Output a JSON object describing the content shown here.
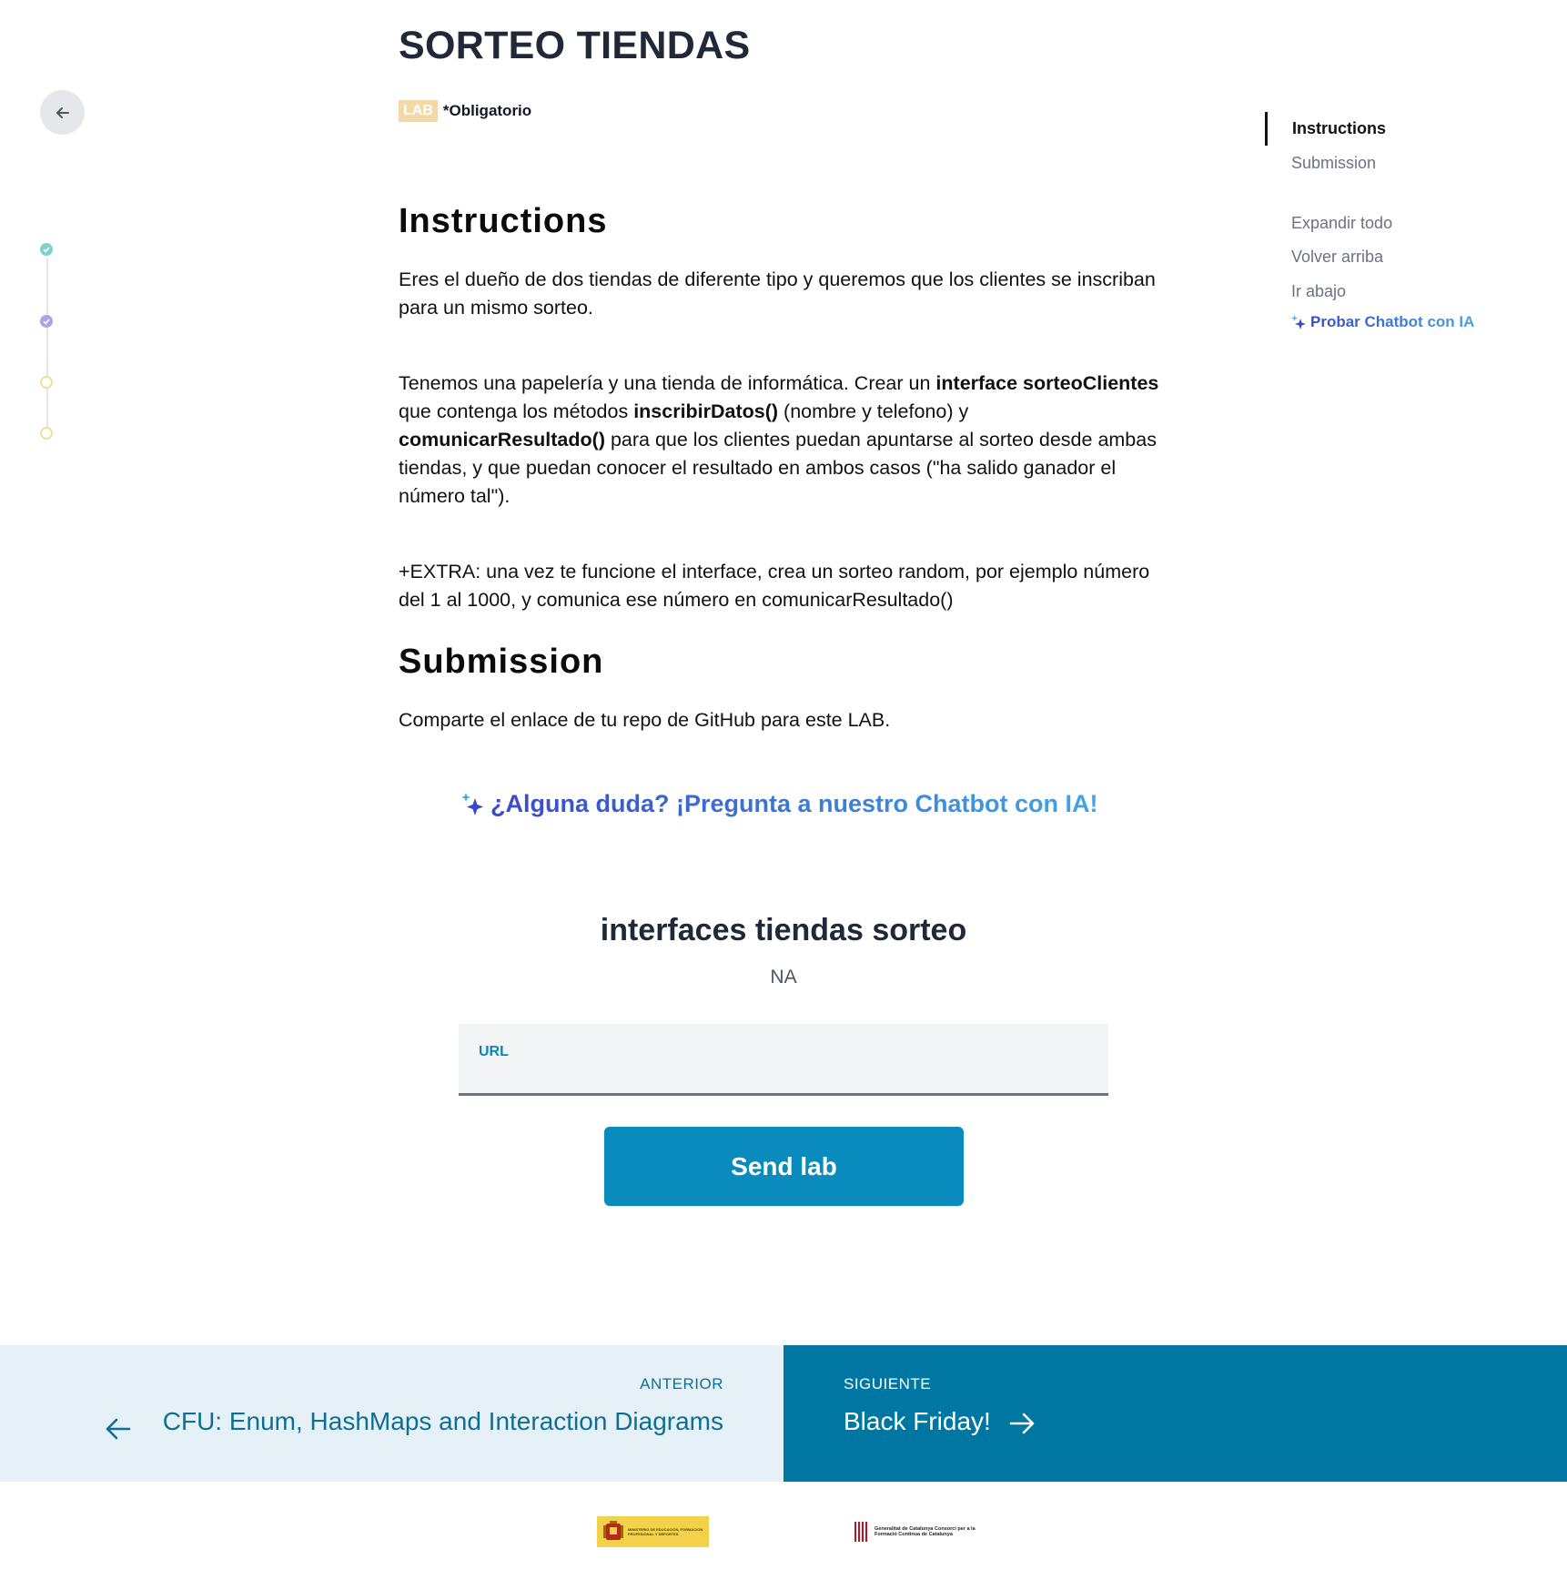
{
  "page": {
    "title": "SORTEO TIENDAS",
    "badge": "LAB",
    "required": "*Obligatorio"
  },
  "instructions": {
    "heading": "Instructions",
    "p1": "Eres el dueño de dos tiendas de diferente tipo y queremos que los clientes se inscriban para un mismo sorteo.",
    "p2": {
      "t1": "Tenemos una papelería y una tienda de informática. Crear un ",
      "b1": "interface sorteoClientes",
      "t2": " que contenga los métodos ",
      "b2": "inscribirDatos()",
      "t3": " (nombre y telefono) y ",
      "b3": "comunicarResultado()",
      "t4": " para que los clientes puedan apuntarse al sorteo desde ambas tiendas, y que puedan conocer el resultado en ambos casos (\"ha salido ganador el número tal\")."
    },
    "p3": "+EXTRA: una vez te funcione el interface, crea un sorteo random, por ejemplo número del 1 al 1000, y comunica ese número en comunicarResultado()"
  },
  "submission": {
    "heading": "Submission",
    "text": "Comparte el enlace de tu repo de GitHub para este LAB."
  },
  "chatbot_cta": "¿Alguna duda? ¡Pregunta a nuestro Chatbot con IA!",
  "card": {
    "title": "interfaces tiendas sorteo",
    "subtitle": "NA",
    "url_label": "URL",
    "url_value": "",
    "submit_label": "Send lab"
  },
  "toc": {
    "items": [
      "Instructions",
      "Submission"
    ],
    "active": "Instructions",
    "actions": [
      "Expandir todo",
      "Volver arriba",
      "Ir abajo"
    ],
    "chatbot": "Probar Chatbot con IA"
  },
  "progress_steps": [
    {
      "state": "done",
      "color": "#7fd3c9"
    },
    {
      "state": "done",
      "color": "#a9a6e3"
    },
    {
      "state": "pending",
      "color": "#f3dea0"
    },
    {
      "state": "pending",
      "color": "#f3dea0"
    }
  ],
  "footer": {
    "prev_kicker": "ANTERIOR",
    "prev_title": "CFU: Enum, HashMaps and Interaction Diagrams",
    "next_kicker": "SIGUIENTE",
    "next_title": "Black Friday!"
  },
  "logos": {
    "spain": "MINISTERIO DE EDUCACIÓN, FORMACIÓN PROFESIONAL Y DEPORTES",
    "catalonia": "Generalitat de Catalunya Consorci per a la Formació Contínua de Catalunya"
  },
  "colors": {
    "accent": "#0a8bbd",
    "next_panel": "#0077a3",
    "prev_panel": "#e6f1f7",
    "badge": "#f3d8a8"
  }
}
